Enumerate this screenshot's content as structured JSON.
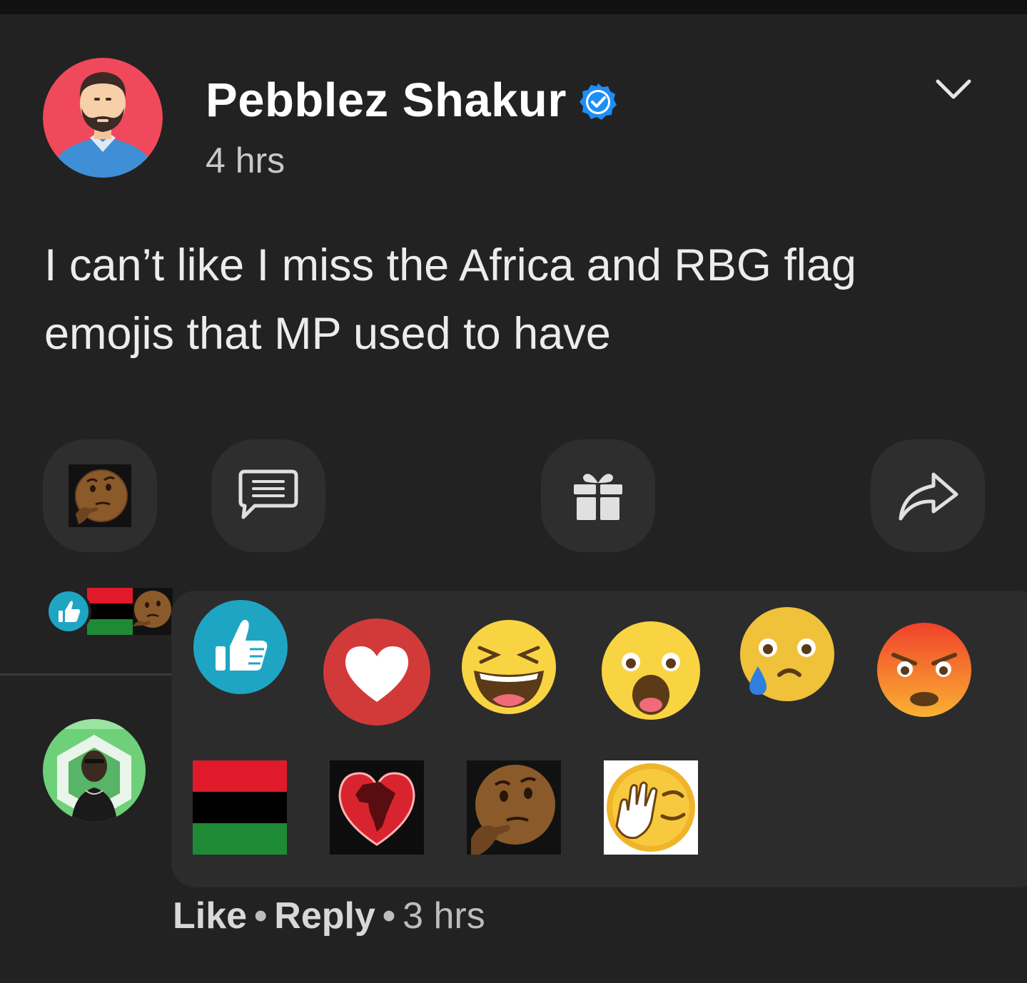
{
  "post": {
    "author_name": "Pebblez Shakur",
    "verified_icon": "verified-badge-icon",
    "time": "4 hrs",
    "text": "I can’t like I miss the Africa and RBG flag emojis that MP used to have"
  },
  "actions": [
    {
      "name": "thinking-reaction-button",
      "icon": "thinking-face-icon"
    },
    {
      "name": "comment-button",
      "icon": "comment-icon"
    },
    {
      "name": "gift-button",
      "icon": "gift-icon"
    },
    {
      "name": "share-button",
      "icon": "share-arrow-icon"
    }
  ],
  "reaction_summary": [
    "like-icon",
    "rbg-flag-icon",
    "thinking-face-icon"
  ],
  "reaction_picker": {
    "standard": [
      "like",
      "love",
      "haha",
      "wow",
      "sad",
      "angry"
    ],
    "custom": [
      "rbg-flag",
      "africa-heart",
      "thinking-face",
      "facepalm"
    ]
  },
  "comment": {
    "like_label": "Like",
    "separator": "•",
    "reply_label": "Reply",
    "time": "3 hrs"
  },
  "colors": {
    "background": "#222222",
    "button_bg": "#2e2e2e",
    "picker_bg": "#2c2c2c",
    "verified": "#1d8ef5",
    "like_blue": "#1fa5c4",
    "love_red": "#d23a3a",
    "rbg_red": "#e01a2a",
    "rbg_black": "#000000",
    "rbg_green": "#1f8a36"
  }
}
